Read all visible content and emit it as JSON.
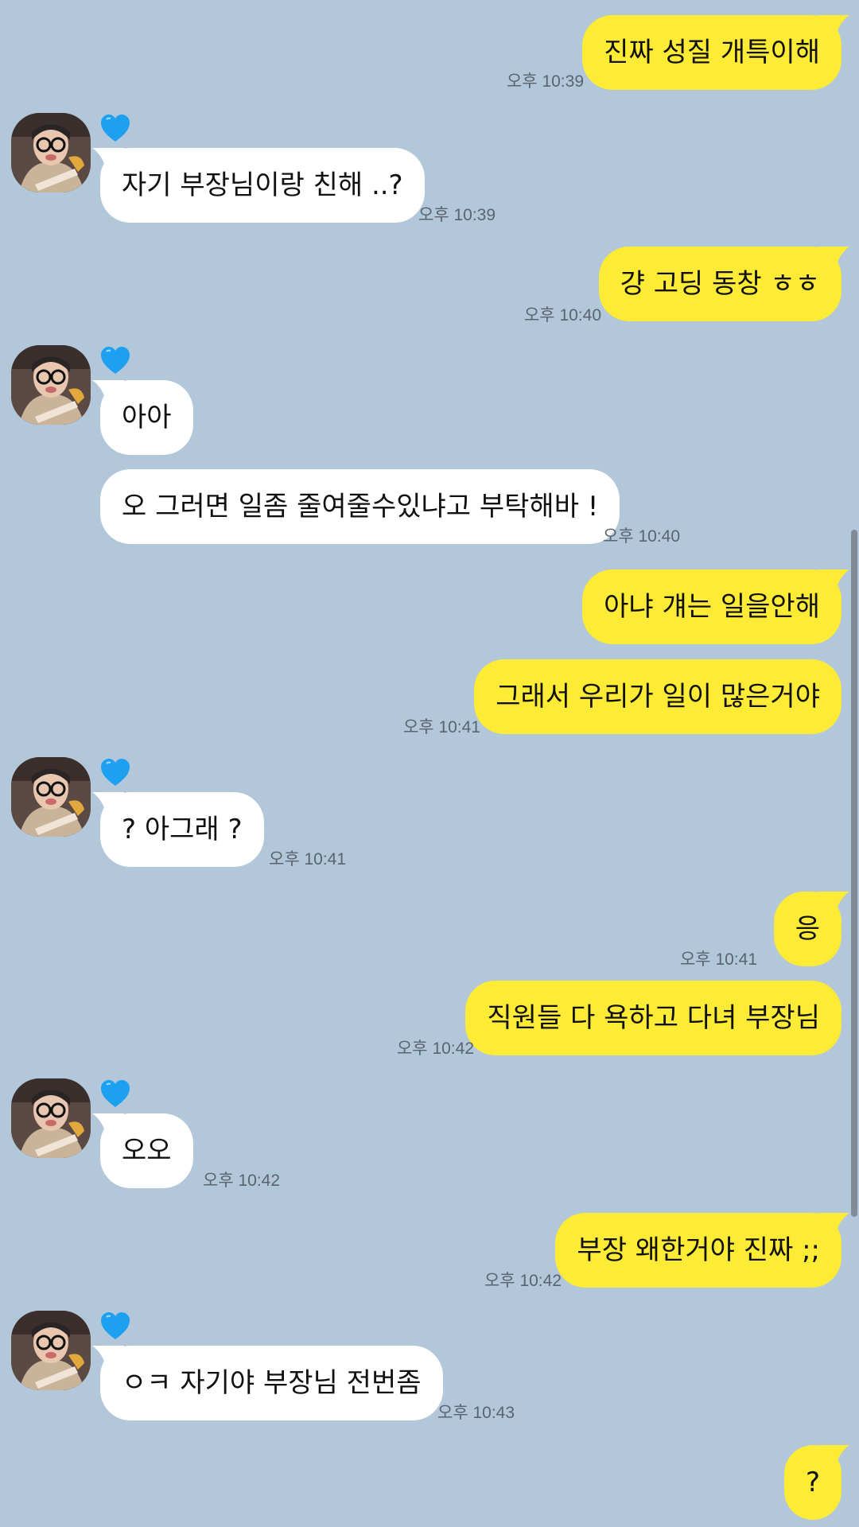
{
  "contact": {
    "avatar_icon": "profile-photo",
    "badge_icon": "blue-heart-icon"
  },
  "colors": {
    "background": "#b2c7d9",
    "incoming_bubble": "#ffffff",
    "outgoing_bubble": "#fdeb36",
    "heart": "#1ea0f0"
  },
  "messages": [
    {
      "dir": "out",
      "text": "진짜 성질 개특이해",
      "time": "오후 10:39"
    },
    {
      "dir": "in",
      "text": "자기 부장님이랑 친해 ..?",
      "time": "오후 10:39"
    },
    {
      "dir": "out",
      "text": "걍 고딩 동창 ㅎㅎ",
      "time": "오후 10:40"
    },
    {
      "dir": "in",
      "text": "아아",
      "time": ""
    },
    {
      "dir": "in",
      "text": "오 그러면 일좀 줄여줄수있냐고 부탁해바 !",
      "time": "오후 10:40"
    },
    {
      "dir": "out",
      "text": "아냐 걔는 일을안해",
      "time": ""
    },
    {
      "dir": "out",
      "text": "그래서 우리가 일이 많은거야",
      "time": "오후 10:41"
    },
    {
      "dir": "in",
      "text": "? 아그래 ?",
      "time": "오후 10:41"
    },
    {
      "dir": "out",
      "text": "응",
      "time": "오후 10:41"
    },
    {
      "dir": "out",
      "text": "직원들 다 욕하고 다녀 부장님",
      "time": "오후 10:42"
    },
    {
      "dir": "in",
      "text": "오오",
      "time": "오후 10:42"
    },
    {
      "dir": "out",
      "text": "부장 왜한거야 진짜 ;;",
      "time": "오후 10:42"
    },
    {
      "dir": "in",
      "text": "ㅇㅋ 자기야 부장님 전번좀",
      "time": "오후 10:43"
    },
    {
      "dir": "out",
      "text": "?",
      "time": ""
    }
  ]
}
